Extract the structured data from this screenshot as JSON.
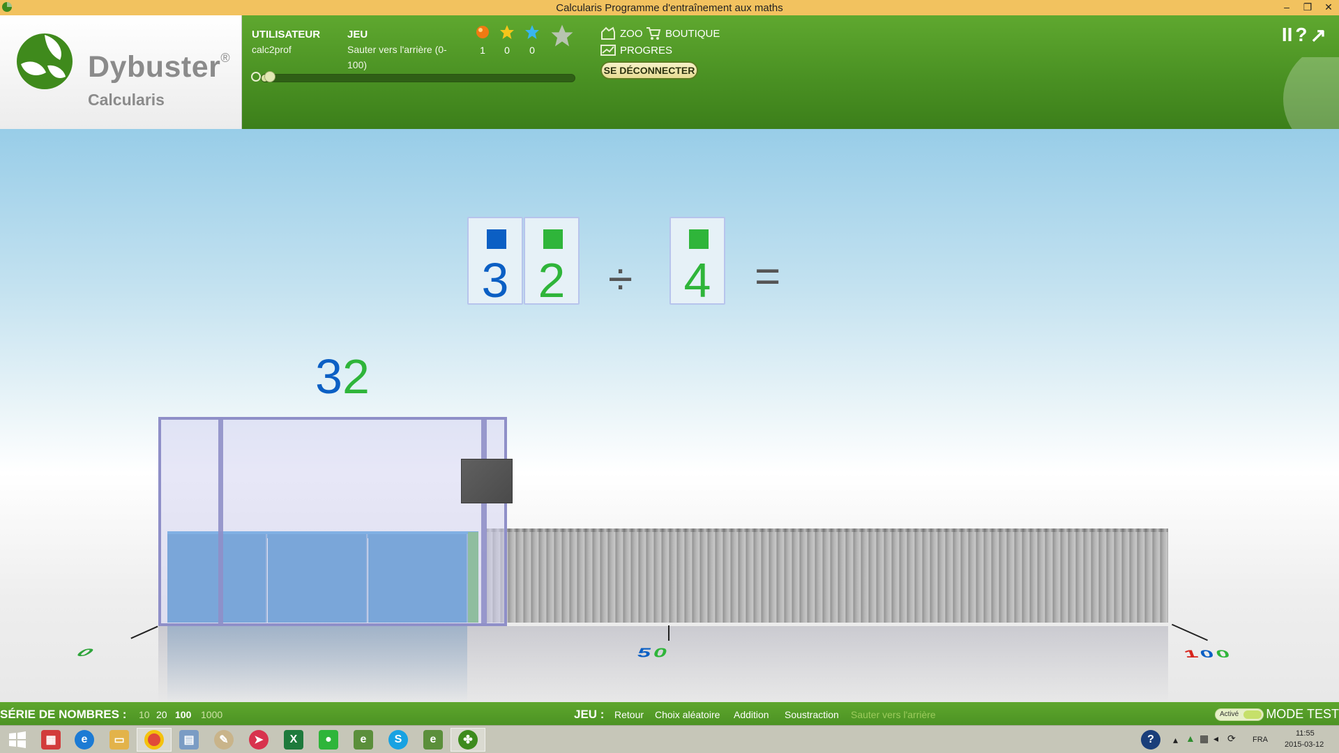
{
  "window": {
    "title": "Calcularis Programme d'entraînement aux maths",
    "minimize_icon": "minimize-icon",
    "restore_icon": "restore-icon",
    "close_icon": "close-icon"
  },
  "logo": {
    "title": "Dybuster",
    "registered": "®",
    "subtitle": "Calcularis"
  },
  "header": {
    "user_label": "UTILISATEUR",
    "user_name": "calc2prof",
    "game_label": "JEU",
    "game_name_line1": "Sauter vers l'arrière (0-",
    "game_name_line2": "100)",
    "scores": [
      {
        "icon": "orange-orb-icon",
        "value": "1"
      },
      {
        "icon": "gold-star-icon",
        "value": "0"
      },
      {
        "icon": "blue-star-icon",
        "value": "0"
      },
      {
        "icon": "silver-star-icon",
        "value": ""
      }
    ],
    "progress_fraction": 0.02,
    "nav": {
      "zoo": "ZOO",
      "shop": "BOUTIQUE",
      "progress": "PROGRES",
      "logout": "SE DÉCONNECTER"
    },
    "tools": {
      "pause": "II",
      "help": "?",
      "fullscreen": "↗"
    }
  },
  "exercise": {
    "dividend_digits": [
      {
        "digit": "3",
        "color": "#0b5fc4"
      },
      {
        "digit": "2",
        "color": "#2fb53a"
      }
    ],
    "divide_sign": "÷",
    "divisor_digit": {
      "digit": "4",
      "color": "#2fb53a"
    },
    "equals_sign": "=",
    "result_digits": [
      {
        "digit": "3",
        "color": "#0b5fc4"
      },
      {
        "digit": "2",
        "color": "#2fb53a"
      }
    ],
    "number_line": {
      "min_label": "0",
      "mid_label": "50",
      "max_label": "100"
    }
  },
  "bottom_bar": {
    "series_label": "SÉRIE DE NOMBRES :",
    "series_options": [
      {
        "label": "10",
        "selected": false
      },
      {
        "label": "20",
        "selected": false
      },
      {
        "label": "100",
        "selected": true
      },
      {
        "label": "1000",
        "selected": false
      }
    ],
    "game_label": "JEU :",
    "game_options": [
      {
        "label": "Retour",
        "selected": false
      },
      {
        "label": "Choix aléatoire",
        "selected": false
      },
      {
        "label": "Addition",
        "selected": false
      },
      {
        "label": "Soustraction",
        "selected": false
      },
      {
        "label": "Sauter vers l'arrière",
        "selected": true
      }
    ],
    "toggle_label": "Activé",
    "mode_label": "MODE TEST"
  },
  "taskbar": {
    "language": "FRA",
    "time": "11:55",
    "date": "2015-03-12"
  }
}
